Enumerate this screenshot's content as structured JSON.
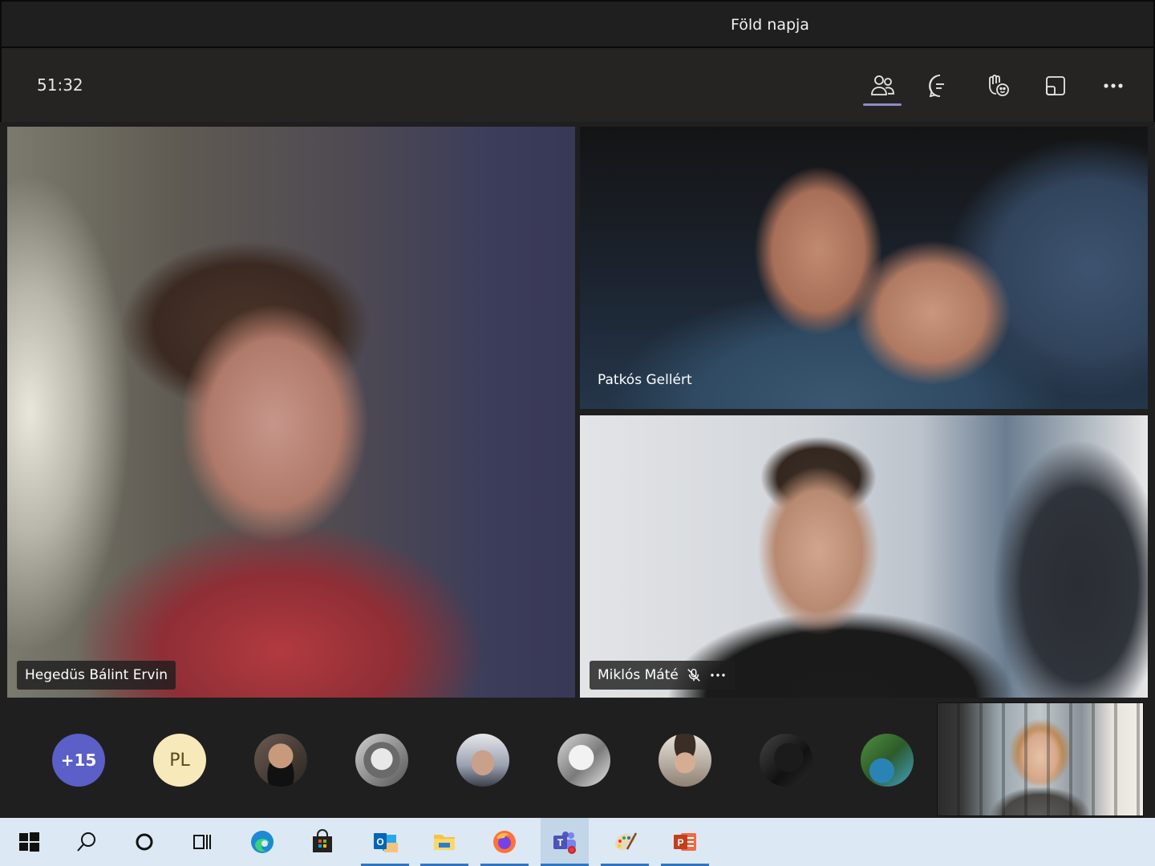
{
  "window": {
    "title": "Föld napja"
  },
  "toolbar": {
    "timer": "51:32",
    "buttons": [
      {
        "icon": "participants-icon",
        "active": true
      },
      {
        "icon": "chat-icon",
        "active": false
      },
      {
        "icon": "reactions-icon",
        "active": false
      },
      {
        "icon": "rooms-icon",
        "active": false
      },
      {
        "icon": "more-icon",
        "active": false
      }
    ]
  },
  "stage": {
    "tiles": [
      {
        "name": "Hegedüs Bálint Ervin",
        "muted": false
      },
      {
        "name": "Patkós Gellért",
        "muted": false
      },
      {
        "name": "Miklós Máté",
        "muted": true
      }
    ]
  },
  "strip": {
    "more_count": "+15",
    "initials": "PL",
    "avatar_count": 7
  },
  "taskbar": {
    "items": [
      "windows-start-icon",
      "search-icon",
      "cortana-icon",
      "task-view-icon",
      "edge-icon",
      "store-icon",
      "outlook-icon",
      "file-explorer-icon",
      "firefox-icon",
      "teams-icon",
      "paint-icon",
      "powerpoint-icon"
    ]
  },
  "colors": {
    "accent": "#5b5fc7",
    "taskbar": "#dce8f3"
  }
}
